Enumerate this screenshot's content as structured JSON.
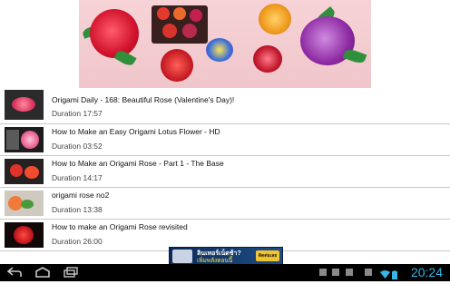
{
  "banner": {
    "alt": ""
  },
  "videos": [
    {
      "title": "Origami Daily - 168: Beautiful Rose (Valentine's Day)!",
      "duration": "Duration 17:57"
    },
    {
      "title": "How to Make an Easy Origami Lotus Flower - HD",
      "duration": "Duration 03:52"
    },
    {
      "title": "How to Make an Origami Rose - Part 1 - The Base",
      "duration": "Duration 14:17"
    },
    {
      "title": "origami rose no2",
      "duration": "Duration 13:38"
    },
    {
      "title": "How to make an Origami Rose revisited",
      "duration": "Duration 26:00"
    }
  ],
  "ad": {
    "line1": "ลินเทอร์เน็ตช้า?",
    "line2": "เพิ่มพลังตอนนี้",
    "button": "ติดต่อเลย"
  },
  "status_bar": {
    "time": "20:24"
  },
  "colors": {
    "clock": "#33b5e5",
    "navbar": "#000000",
    "divider": "#c8c8c8"
  }
}
